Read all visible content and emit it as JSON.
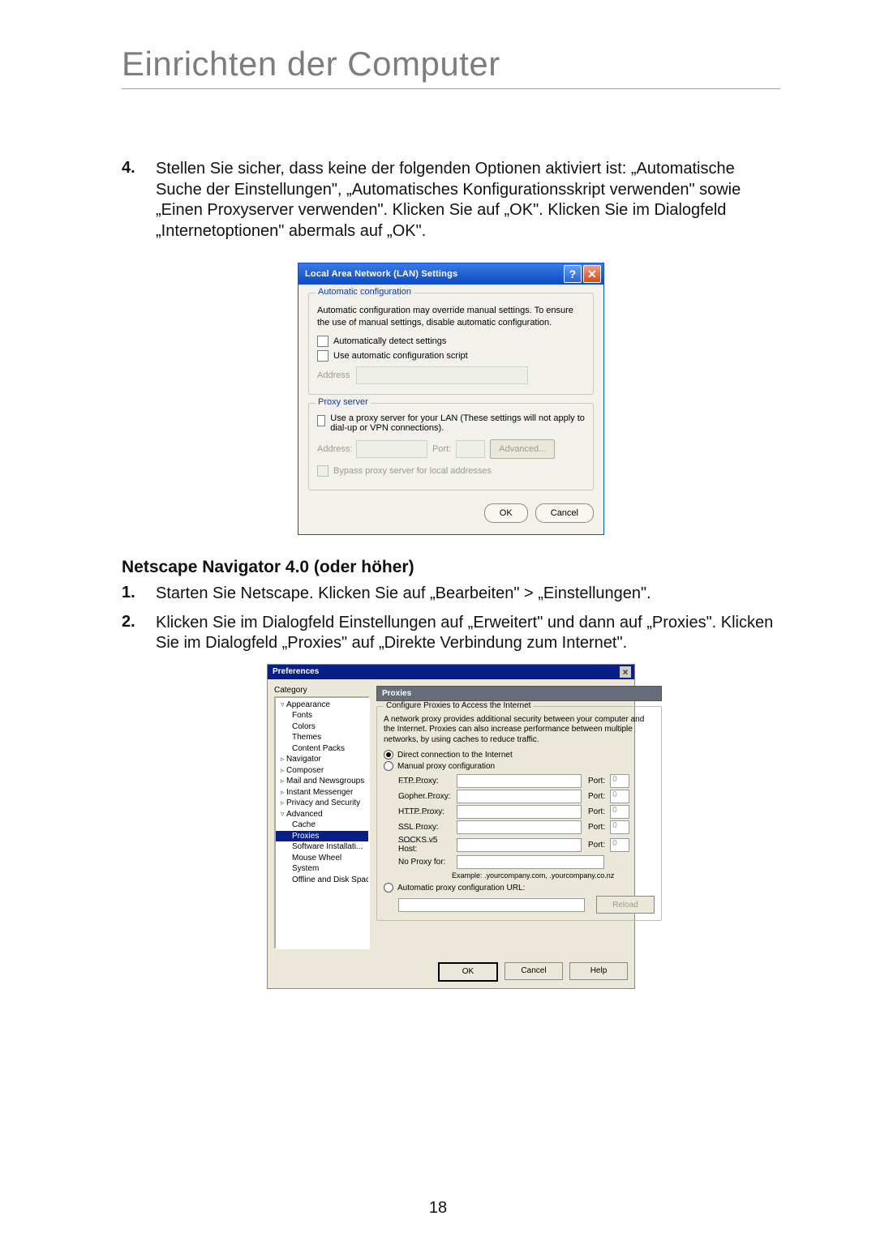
{
  "document": {
    "title": "Einrichten der Computer",
    "page_number": "18"
  },
  "step4": {
    "number": "4.",
    "text": "Stellen Sie sicher, dass keine der folgenden Optionen aktiviert ist: „Automatische Suche der Einstellungen\", „Automatisches Konfigurationsskript verwenden\" sowie „Einen Proxyserver verwenden\". Klicken Sie auf „OK\". Klicken Sie im Dialogfeld „Internetoptionen\" abermals auf „OK\"."
  },
  "lan": {
    "title": "Local Area Network (LAN) Settings",
    "help_btn": "?",
    "close_btn": "✕",
    "autoconf": {
      "legend": "Automatic configuration",
      "text": "Automatic configuration may override manual settings.  To ensure the use of manual settings, disable automatic configuration.",
      "detect": "Automatically detect settings",
      "script": "Use automatic configuration script",
      "address_lbl": "Address"
    },
    "proxy": {
      "legend": "Proxy server",
      "text": "Use a proxy server for your LAN (These settings will not apply to dial-up or VPN connections).",
      "address_lbl": "Address:",
      "port_lbl": "Port:",
      "advanced": "Advanced...",
      "bypass": "Bypass proxy server for local addresses"
    },
    "ok": "OK",
    "cancel": "Cancel"
  },
  "netscape_section": {
    "heading": "Netscape Navigator 4.0 (oder höher)",
    "step1_num": "1.",
    "step1": "Starten Sie Netscape. Klicken Sie auf „Bearbeiten\" > „Einstellungen\".",
    "step2_num": "2.",
    "step2": "Klicken Sie im Dialogfeld Einstellungen auf „Erweitert\" und dann auf „Proxies\". Klicken Sie im Dialogfeld „Proxies\" auf „Direkte Verbindung zum Internet\"."
  },
  "pref": {
    "title": "Preferences",
    "close": "×",
    "category_label": "Category",
    "categories": {
      "appearance": "Appearance",
      "fonts": "Fonts",
      "colors": "Colors",
      "themes": "Themes",
      "content_packs": "Content Packs",
      "navigator": "Navigator",
      "composer": "Composer",
      "mail": "Mail and Newsgroups",
      "im": "Instant Messenger",
      "privacy": "Privacy and Security",
      "advanced": "Advanced",
      "cache": "Cache",
      "proxies": "Proxies",
      "swinst": "Software Installati...",
      "mouse": "Mouse Wheel",
      "system": "System",
      "offline": "Offline and Disk Space"
    },
    "panel_title": "Proxies",
    "fs_legend": "Configure Proxies to Access the Internet",
    "desc": "A network proxy provides additional security between your computer and the Internet. Proxies can also increase performance between multiple networks, by using caches to reduce traffic.",
    "r_direct": "Direct connection to the Internet",
    "r_manual": "Manual proxy configuration",
    "rows": {
      "ftp": "FTP Proxy:",
      "gopher": "Gopher Proxy:",
      "http": "HTTP Proxy:",
      "ssl": "SSL Proxy:",
      "socks": "SOCKS v5 Host:",
      "noproxy": "No Proxy for:"
    },
    "port_lbl": "Port:",
    "port_ph": "0",
    "example": "Example: .yourcompany.com, .yourcompany.co.nz",
    "r_auto": "Automatic proxy configuration URL:",
    "reload": "Reload",
    "ok": "OK",
    "cancel": "Cancel",
    "help": "Help"
  }
}
